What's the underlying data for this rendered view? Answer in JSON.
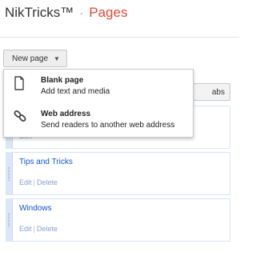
{
  "header": {
    "blog_name": "NikTricks™",
    "separator": "·",
    "section": "Pages"
  },
  "toolbar": {
    "new_page_label": "New page",
    "tabs_label": "abs",
    "caret": "▼"
  },
  "new_page_menu": [
    {
      "title": "Blank page",
      "description": "Add text and media",
      "icon": "blank-page-icon"
    },
    {
      "title": "Web address",
      "description": "Send readers to another web address",
      "icon": "link-icon"
    }
  ],
  "pages": [
    {
      "title": "",
      "actions": [
        "Edit"
      ]
    },
    {
      "title": "Tips and Tricks",
      "actions": [
        "Edit",
        "Delete"
      ]
    },
    {
      "title": "Windows",
      "actions": [
        "Edit",
        "Delete"
      ]
    }
  ],
  "colors": {
    "section_accent": "#dd4b39",
    "link": "#1155cc",
    "card_border": "#d9e4f4"
  }
}
